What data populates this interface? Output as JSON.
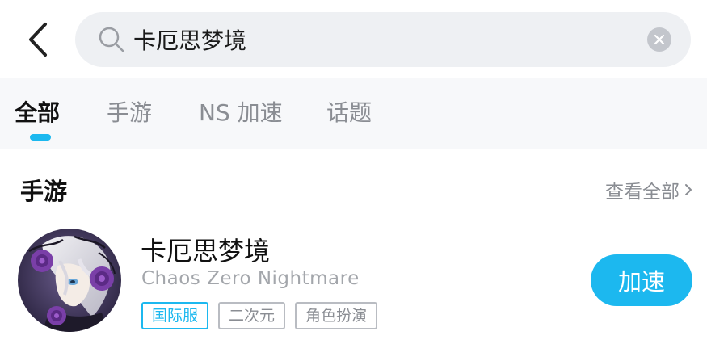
{
  "search": {
    "value": "卡厄思梦境",
    "placeholder": ""
  },
  "tabs": [
    {
      "label": "全部",
      "active": true
    },
    {
      "label": "手游",
      "active": false
    },
    {
      "label": "NS 加速",
      "active": false
    },
    {
      "label": "话题",
      "active": false
    }
  ],
  "section": {
    "title": "手游",
    "view_all": "查看全部"
  },
  "game": {
    "title": "卡厄思梦境",
    "subtitle": "Chaos Zero Nightmare",
    "tags": [
      "国际服",
      "二次元",
      "角色扮演"
    ],
    "action_label": "加速"
  },
  "colors": {
    "accent": "#1cb8ef",
    "search_bg": "#eef0f3",
    "tab_bg": "#f7f8fa",
    "muted_text": "#8a8d93"
  },
  "icons": [
    "back-chevron-icon",
    "search-icon",
    "clear-icon",
    "chevron-right-icon"
  ]
}
